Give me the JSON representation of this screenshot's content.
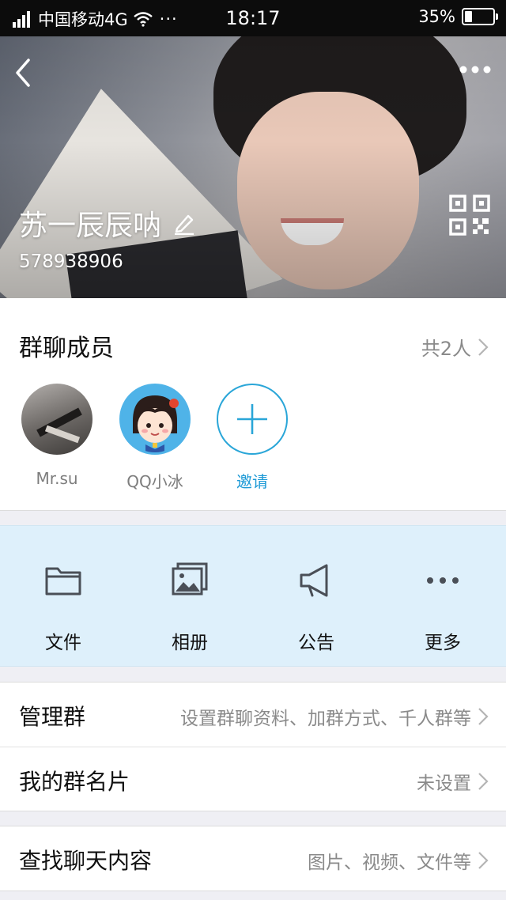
{
  "status_bar": {
    "carrier": "中国移动4G",
    "dots": "···",
    "time": "18:17",
    "battery_text": "35%",
    "battery_level": 0.35
  },
  "header": {
    "group_name": "苏一辰辰呐",
    "group_id": "578938906",
    "icons": [
      "back-icon",
      "more-icon",
      "edit-icon",
      "qr-code-icon"
    ]
  },
  "members": {
    "title": "群聊成员",
    "count_text": "共2人",
    "list": [
      {
        "name": "Mr.su"
      },
      {
        "name": "QQ小冰"
      }
    ],
    "invite_label": "邀请"
  },
  "actions": [
    {
      "label": "文件",
      "icon": "folder-icon"
    },
    {
      "label": "相册",
      "icon": "album-icon"
    },
    {
      "label": "公告",
      "icon": "megaphone-icon"
    },
    {
      "label": "更多",
      "icon": "more-dots-icon"
    }
  ],
  "settings": {
    "manage": {
      "title": "管理群",
      "subtitle": "设置群聊资料、加群方式、千人群等"
    },
    "card": {
      "title": "我的群名片",
      "subtitle": "未设置"
    },
    "search": {
      "title": "查找聊天内容",
      "subtitle": "图片、视频、文件等"
    }
  },
  "colors": {
    "accent": "#1e9ad6",
    "action_background": "#def0fb",
    "page_background": "#efeff4"
  }
}
